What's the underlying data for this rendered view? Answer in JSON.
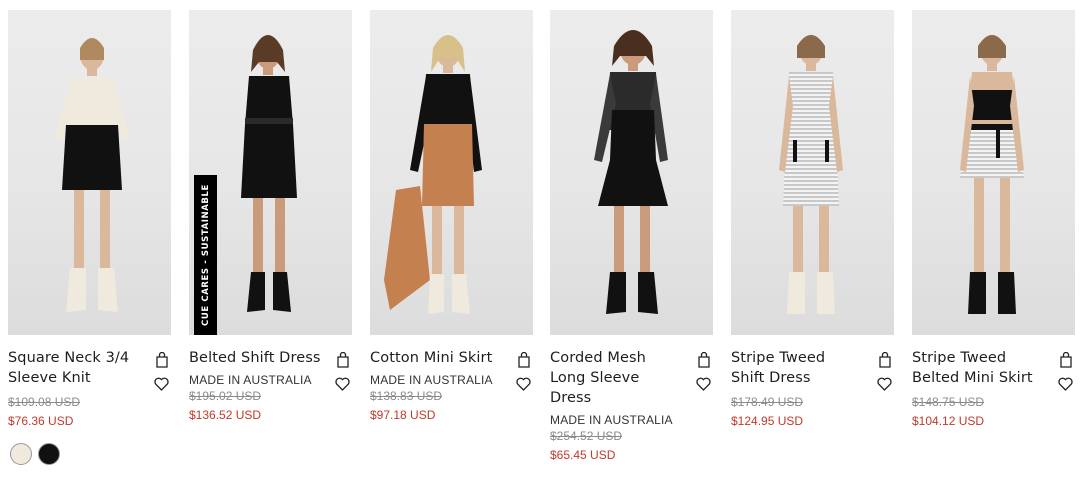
{
  "products": [
    {
      "name": "Square Neck 3/4 Sleeve Knit",
      "made_in": "",
      "was_price": "$109.08 USD",
      "price": "$76.36 USD",
      "swatches": [
        "#efe9de",
        "#111111"
      ],
      "badge": "",
      "icons": {
        "bag": "shopping-bag-icon",
        "wishlist": "heart-icon"
      }
    },
    {
      "name": "Belted Shift Dress",
      "made_in": "MADE IN AUSTRALIA",
      "was_price": "$195.02 USD",
      "price": "$136.52 USD",
      "swatches": [],
      "badge": "CUE CARES - SUSTAINABLE",
      "icons": {
        "bag": "shopping-bag-icon",
        "wishlist": "heart-icon"
      }
    },
    {
      "name": "Cotton Mini Skirt",
      "made_in": "MADE IN AUSTRALIA",
      "was_price": "$138.83 USD",
      "price": "$97.18 USD",
      "swatches": [],
      "badge": "",
      "icons": {
        "bag": "shopping-bag-icon",
        "wishlist": "heart-icon"
      }
    },
    {
      "name": "Corded Mesh Long Sleeve Dress",
      "made_in": "MADE IN AUSTRALIA",
      "was_price": "$254.52 USD",
      "price": "$65.45 USD",
      "swatches": [],
      "badge": "",
      "icons": {
        "bag": "shopping-bag-icon",
        "wishlist": "heart-icon"
      }
    },
    {
      "name": "Stripe Tweed Shift Dress",
      "made_in": "",
      "was_price": "$178.49 USD",
      "price": "$124.95 USD",
      "swatches": [],
      "badge": "",
      "icons": {
        "bag": "shopping-bag-icon",
        "wishlist": "heart-icon"
      }
    },
    {
      "name": "Stripe Tweed Belted Mini Skirt",
      "made_in": "",
      "was_price": "$148.75 USD",
      "price": "$104.12 USD",
      "swatches": [],
      "badge": "",
      "icons": {
        "bag": "shopping-bag-icon",
        "wishlist": "heart-icon"
      }
    }
  ],
  "colors": {
    "sale_price": "#c0392b",
    "was_price": "#8a8a8a",
    "text": "#1e1e1e"
  }
}
